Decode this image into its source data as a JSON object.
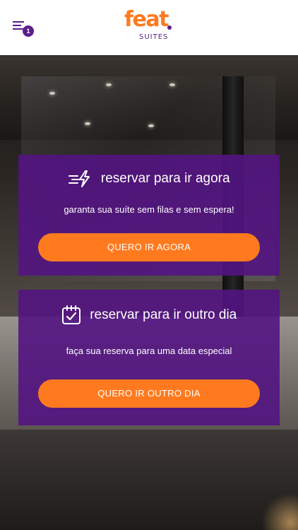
{
  "header": {
    "notification_count": "1",
    "logo": {
      "word": "feat",
      "sub": "SUITES"
    }
  },
  "cards": [
    {
      "icon": "fast-bolt-icon",
      "title": "reservar para ir agora",
      "subtitle": "garanta sua suíte sem filas e sem espera!",
      "button_label": "QUERO IR AGORA"
    },
    {
      "icon": "calendar-check-icon",
      "title": "reservar para ir outro dia",
      "subtitle": "faça sua reserva para uma data especial",
      "button_label": "QUERO IR OUTRO DIA"
    }
  ],
  "colors": {
    "brand_orange": "#ff7a1f",
    "brand_purple": "#5b1e8a",
    "card_background": "#53148299"
  }
}
